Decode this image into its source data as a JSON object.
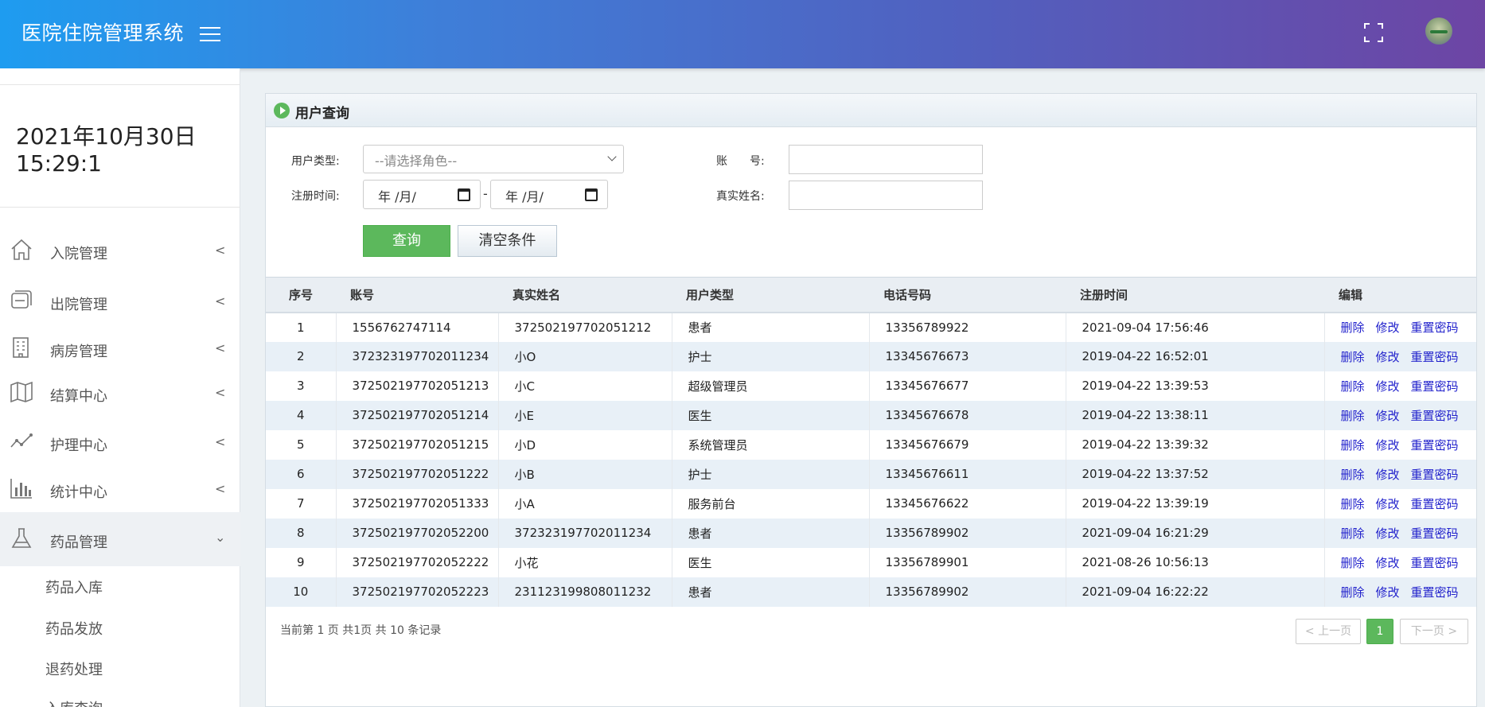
{
  "header": {
    "title": "医院住院管理系统"
  },
  "sidebar": {
    "clock": {
      "date": "2021年10月30日",
      "time": "15:29:1"
    },
    "items": [
      {
        "label": "入院管理",
        "icon": "home-icon"
      },
      {
        "label": "出院管理",
        "icon": "layers-icon"
      },
      {
        "label": "病房管理",
        "icon": "building-icon"
      },
      {
        "label": "结算中心",
        "icon": "map-icon"
      },
      {
        "label": "护理中心",
        "icon": "line-chart-icon"
      },
      {
        "label": "统计中心",
        "icon": "bar-chart-icon"
      },
      {
        "label": "药品管理",
        "icon": "flask-icon"
      }
    ],
    "subitems": [
      "药品入库",
      "药品发放",
      "退药处理",
      "入库查询"
    ]
  },
  "panel": {
    "title": "用户查询",
    "form": {
      "user_type_label": "用户类型:",
      "user_type_value": "--请选择角色--",
      "reg_time_label": "注册时间:",
      "date_start": "年 /月/",
      "date_end": "年 /月/",
      "date_sep": "-",
      "account_label": "账　　号:",
      "realname_label": "真实姓名:",
      "query_button": "查询",
      "clear_button": "清空条件"
    },
    "table": {
      "headers": [
        "序号",
        "账号",
        "真实姓名",
        "用户类型",
        "电话号码",
        "注册时间",
        "编辑"
      ],
      "actions": [
        "删除",
        "修改",
        "重置密码"
      ],
      "rows": [
        [
          "1",
          "1556762747114",
          "372502197702051212",
          "患者",
          "13356789922",
          "2021-09-04 17:56:46"
        ],
        [
          "2",
          "372323197702011234",
          "小O",
          "护士",
          "13345676673",
          "2019-04-22 16:52:01"
        ],
        [
          "3",
          "372502197702051213",
          "小C",
          "超级管理员",
          "13345676677",
          "2019-04-22 13:39:53"
        ],
        [
          "4",
          "372502197702051214",
          "小E",
          "医生",
          "13345676678",
          "2019-04-22 13:38:11"
        ],
        [
          "5",
          "372502197702051215",
          "小D",
          "系统管理员",
          "13345676679",
          "2019-04-22 13:39:32"
        ],
        [
          "6",
          "372502197702051222",
          "小B",
          "护士",
          "13345676611",
          "2019-04-22 13:37:52"
        ],
        [
          "7",
          "372502197702051333",
          "小A",
          "服务前台",
          "13345676622",
          "2019-04-22 13:39:19"
        ],
        [
          "8",
          "372502197702052200",
          "372323197702011234",
          "患者",
          "13356789902",
          "2021-09-04 16:21:29"
        ],
        [
          "9",
          "372502197702052222",
          "小花",
          "医生",
          "13356789901",
          "2021-08-26 10:56:13"
        ],
        [
          "10",
          "372502197702052223",
          "231123199808011232",
          "患者",
          "13356789902",
          "2021-09-04 16:22:22"
        ]
      ]
    },
    "footer": {
      "info": "当前第 1 页  共1页  共 10 条记录"
    },
    "pager": {
      "prev": "< 上一页",
      "current": "1",
      "next": "下一页 >"
    }
  }
}
